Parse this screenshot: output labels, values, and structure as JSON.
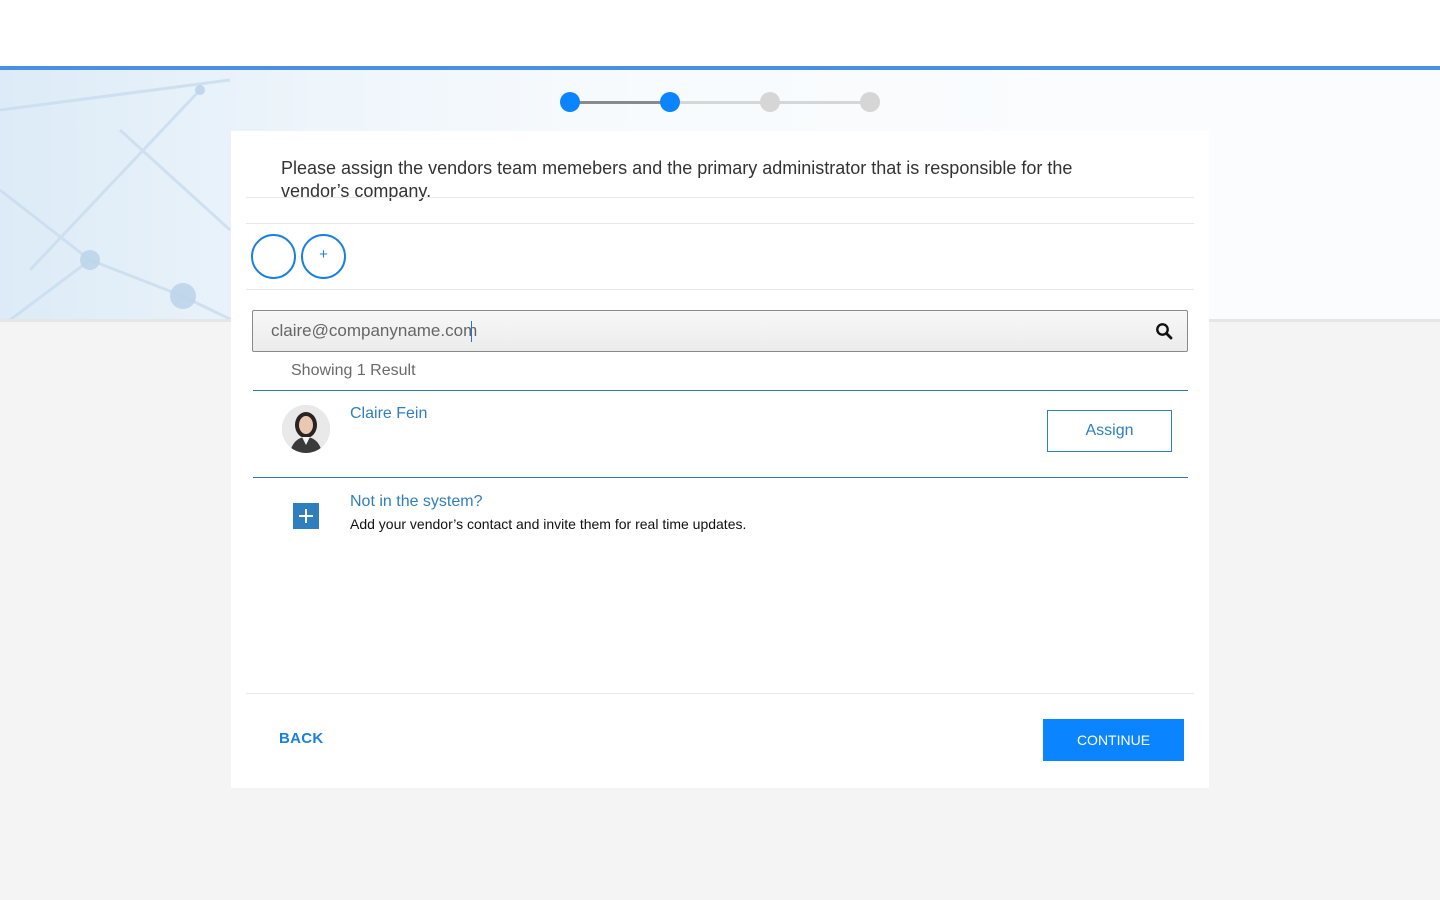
{
  "stepper": {
    "current_step": 2,
    "total_steps": 4,
    "colors": {
      "active": "#0a84ff",
      "inactive": "#d6d6d6",
      "line_done": "#8a8a8a",
      "line_pending": "#d6d6d6"
    }
  },
  "intro": {
    "text": "Please assign the vendors team memebers and the primary administrator that is responsible for the vendor’s company."
  },
  "member_circles": [
    {
      "icon": "empty-slot",
      "label": ""
    },
    {
      "icon": "plus-icon",
      "label": "+"
    }
  ],
  "search": {
    "value": "claire@companyname.com",
    "placeholder": "",
    "icon": "search-icon"
  },
  "results": {
    "count_text": "Showing 1 Result",
    "items": [
      {
        "name": "Claire Fein",
        "avatar": "person-avatar",
        "action_label": "Assign"
      }
    ]
  },
  "not_in_system": {
    "title": "Not in the system?",
    "description": "Add your vendor’s contact and invite them for real time updates.",
    "icon": "plus-square-icon"
  },
  "footer": {
    "back_label": "BACK",
    "continue_label": "CONTINUE"
  },
  "colors": {
    "accent": "#0a84ff",
    "link": "#2f7fbf",
    "top_rule": "#4a90e2"
  }
}
